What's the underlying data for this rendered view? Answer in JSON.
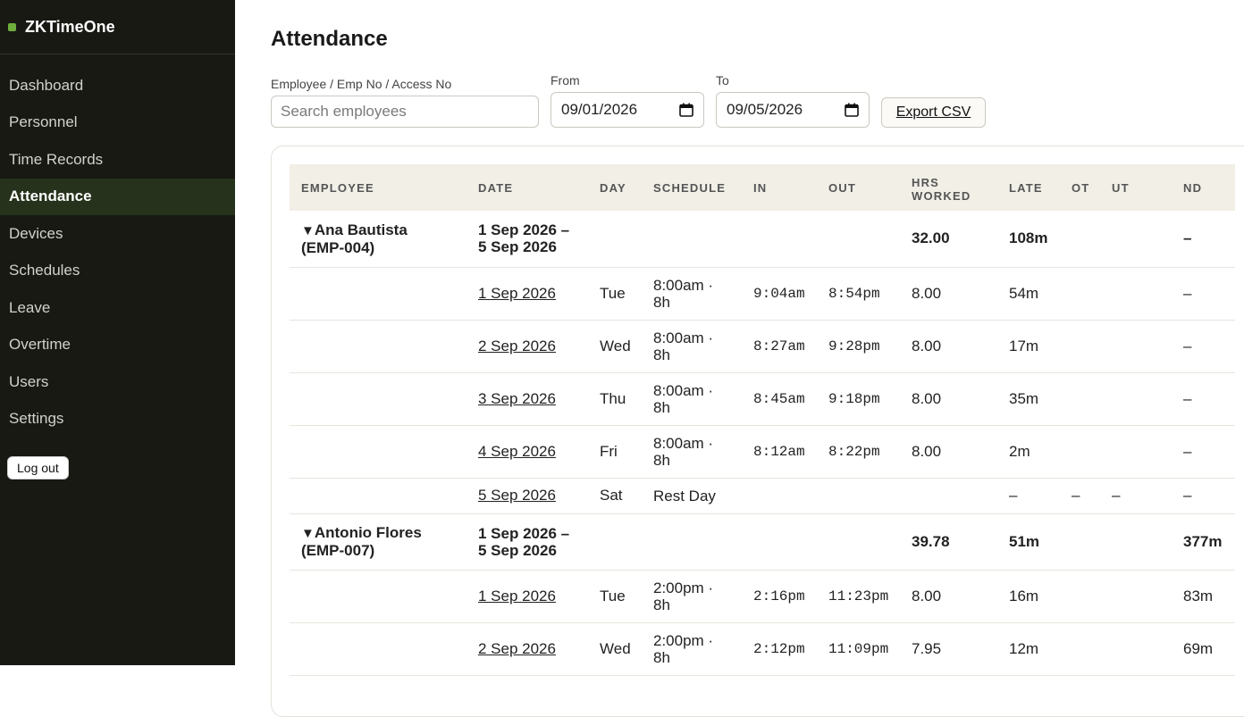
{
  "app": {
    "name": "ZKTimeOne"
  },
  "nav": {
    "items": [
      {
        "label": "Dashboard"
      },
      {
        "label": "Personnel"
      },
      {
        "label": "Time Records"
      },
      {
        "label": "Attendance"
      },
      {
        "label": "Devices"
      },
      {
        "label": "Schedules"
      },
      {
        "label": "Leave"
      },
      {
        "label": "Overtime"
      },
      {
        "label": "Users"
      },
      {
        "label": "Settings"
      }
    ],
    "active": "Attendance",
    "logout_label": "Log out"
  },
  "page": {
    "title": "Attendance"
  },
  "filters": {
    "search_label": "Employee / Emp No / Access No",
    "search_placeholder": "Search employees",
    "from_label": "From",
    "from_value": "09/01/2026",
    "to_label": "To",
    "to_value": "09/05/2026",
    "export_label": "Export CSV"
  },
  "table": {
    "headers": [
      "EMPLOYEE",
      "DATE",
      "DAY",
      "SCHEDULE",
      "IN",
      "OUT",
      "HRS WORKED",
      "LATE",
      "OT",
      "UT",
      "ND"
    ],
    "groups": [
      {
        "toggle": "▼",
        "employee": "Ana Bautista",
        "emp_no": "(EMP-004)",
        "range_start": "1 Sep 2026 –",
        "range_end": "5 Sep 2026",
        "hrs": "32.00",
        "late": "108m",
        "ot": "",
        "ut": "",
        "nd": "–",
        "rows": [
          {
            "date": "1 Sep 2026",
            "day": "Tue",
            "sched_1": "8:00am ·",
            "sched_2": "8h",
            "in": "9:04am",
            "out": "8:54pm",
            "hrs": "8.00",
            "late": "54m",
            "ot": "",
            "ut": "",
            "nd": "–"
          },
          {
            "date": "2 Sep 2026",
            "day": "Wed",
            "sched_1": "8:00am ·",
            "sched_2": "8h",
            "in": "8:27am",
            "out": "9:28pm",
            "hrs": "8.00",
            "late": "17m",
            "ot": "",
            "ut": "",
            "nd": "–"
          },
          {
            "date": "3 Sep 2026",
            "day": "Thu",
            "sched_1": "8:00am ·",
            "sched_2": "8h",
            "in": "8:45am",
            "out": "9:18pm",
            "hrs": "8.00",
            "late": "35m",
            "ot": "",
            "ut": "",
            "nd": "–"
          },
          {
            "date": "4 Sep 2026",
            "day": "Fri",
            "sched_1": "8:00am ·",
            "sched_2": "8h",
            "in": "8:12am",
            "out": "8:22pm",
            "hrs": "8.00",
            "late": "2m",
            "ot": "",
            "ut": "",
            "nd": "–"
          },
          {
            "date": "5 Sep 2026",
            "day": "Sat",
            "sched_1": "Rest Day",
            "sched_2": "",
            "in": "",
            "out": "",
            "hrs": "",
            "late": "–",
            "ot": "–",
            "ut": "–",
            "nd": "–"
          }
        ]
      },
      {
        "toggle": "▼",
        "employee": "Antonio Flores",
        "emp_no": "(EMP-007)",
        "range_start": "1 Sep 2026 –",
        "range_end": "5 Sep 2026",
        "hrs": "39.78",
        "late": "51m",
        "ot": "",
        "ut": "",
        "nd": "377m",
        "rows": [
          {
            "date": "1 Sep 2026",
            "day": "Tue",
            "sched_1": "2:00pm ·",
            "sched_2": "8h",
            "in": "2:16pm",
            "out": "11:23pm",
            "hrs": "8.00",
            "late": "16m",
            "ot": "",
            "ut": "",
            "nd": "83m"
          },
          {
            "date": "2 Sep 2026",
            "day": "Wed",
            "sched_1": "2:00pm ·",
            "sched_2": "8h",
            "in": "2:12pm",
            "out": "11:09pm",
            "hrs": "7.95",
            "late": "12m",
            "ot": "",
            "ut": "",
            "nd": "69m"
          }
        ]
      }
    ]
  }
}
